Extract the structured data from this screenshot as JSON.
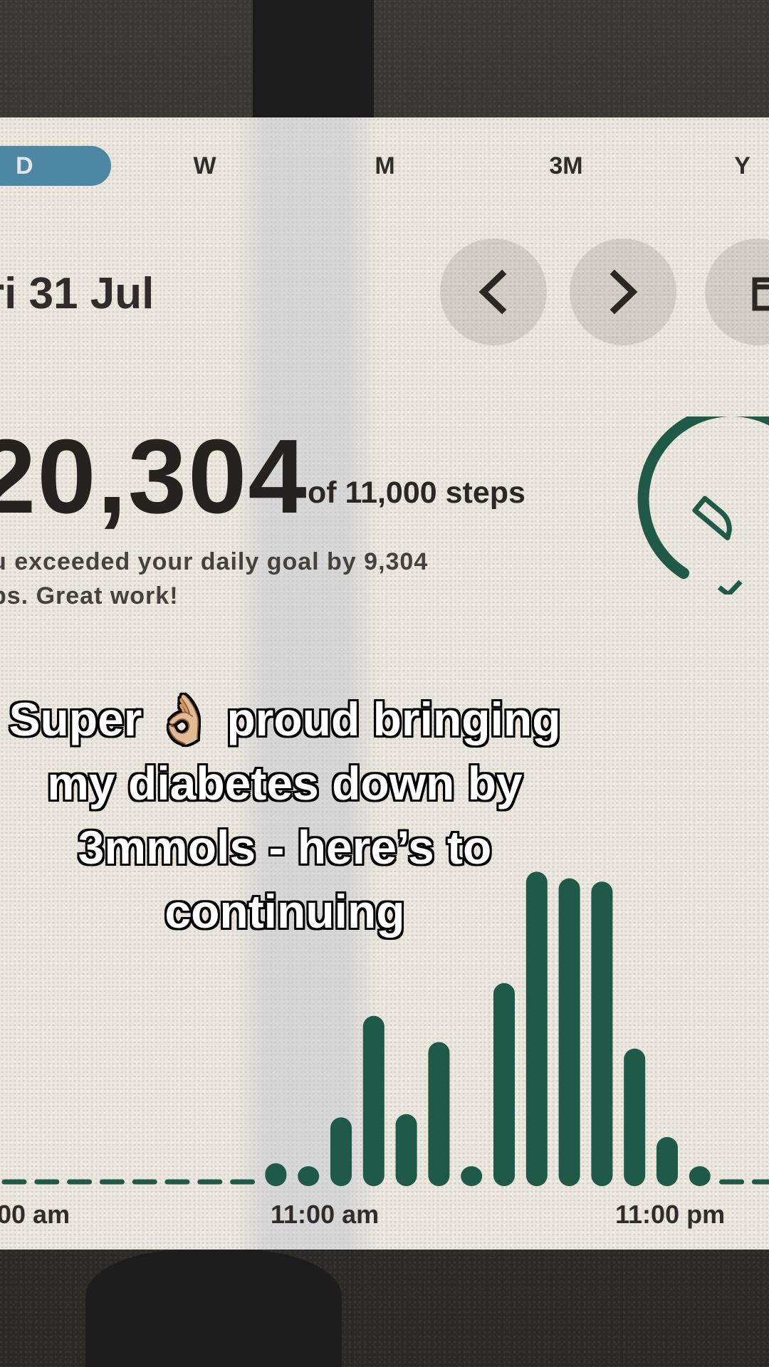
{
  "tabs": [
    {
      "label": "D",
      "active": true
    },
    {
      "label": "W",
      "active": false
    },
    {
      "label": "M",
      "active": false
    },
    {
      "label": "3M",
      "active": false
    },
    {
      "label": "Y",
      "active": false
    }
  ],
  "date_label": "ri 31 Jul",
  "steps": {
    "count": "20,304",
    "goal_text": "of 11,000 steps",
    "message_line1": "u exceeded your daily goal by 9,304",
    "message_line2": "ps. Great work!"
  },
  "caption": {
    "line1": "Super 👌🏼 proud bringing",
    "line2": "my diabetes down by",
    "line3": "3mmols - here’s to",
    "line4": "continuing"
  },
  "colors": {
    "accent_tab": "#4d87a4",
    "bar_green": "#1f5a48",
    "card_bg": "#ebe7df"
  },
  "icons": [
    "chevron-left-icon",
    "chevron-right-icon",
    "calendar-icon",
    "shoe-icon",
    "check-icon"
  ],
  "chart_data": {
    "type": "bar",
    "categories": [
      "0",
      "1",
      "2",
      "3",
      "4",
      "5",
      "6",
      "7",
      "8",
      "9",
      "10",
      "11",
      "12",
      "13",
      "14",
      "15",
      "16",
      "17",
      "18",
      "19",
      "20",
      "21",
      "22",
      "23"
    ],
    "values": [
      0,
      0,
      0,
      0,
      0,
      0,
      0,
      0,
      350,
      40,
      1050,
      2600,
      1100,
      2200,
      180,
      3100,
      4800,
      4700,
      4650,
      2100,
      750,
      180,
      0,
      0
    ],
    "x_tick_labels": [
      "00 am",
      "11:00 am",
      "11:00 pm"
    ],
    "ylim": [
      0,
      5000
    ],
    "grid": false
  }
}
